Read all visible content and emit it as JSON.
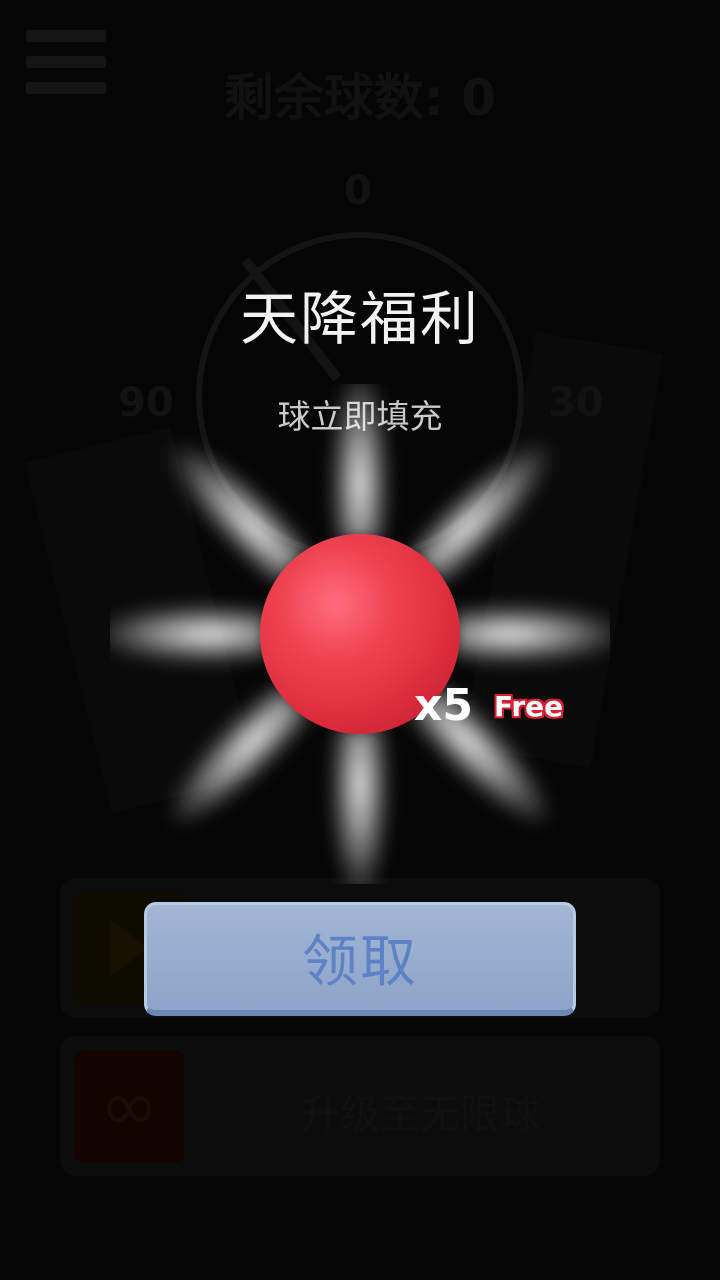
{
  "background": {
    "balls_left_label": "剩余球数: 0",
    "dial_ticks": {
      "top": "0",
      "left": "90",
      "right": "30"
    },
    "upgrade_label": "升级至无限球",
    "infinity_glyph": "∞",
    "icons": [
      "menu-icon",
      "play-icon",
      "infinity-icon"
    ]
  },
  "popup": {
    "title": "天降福利",
    "subtitle": "球立即填充",
    "ball_color": "#e8394a",
    "count": "x5",
    "badge": "Free",
    "badge_color": "#d81f32",
    "claim_button": "领取",
    "claim_button_color": "#94aacd"
  }
}
